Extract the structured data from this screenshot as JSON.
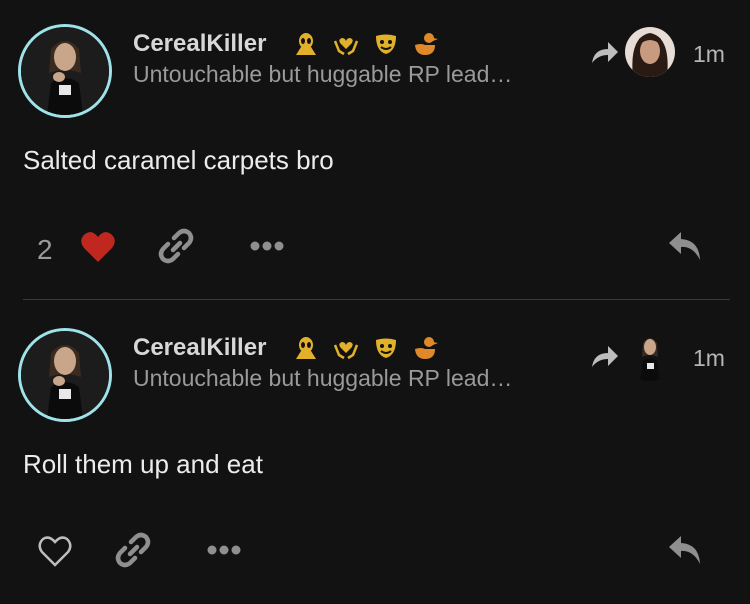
{
  "posts": [
    {
      "username": "CerealKiller",
      "bio": "Untouchable but huggable RP lead…",
      "time": "1m",
      "content": "Salted caramel carpets bro",
      "like_count": "2",
      "liked": true,
      "badges": [
        "alien-badge-icon",
        "heart-hands-badge-icon",
        "theater-masks-badge-icon",
        "duck-badge-icon"
      ]
    },
    {
      "username": "CerealKiller",
      "bio": "Untouchable but huggable RP lead…",
      "time": "1m",
      "content": "Roll them up and eat",
      "like_count": "",
      "liked": false,
      "badges": [
        "alien-badge-icon",
        "heart-hands-badge-icon",
        "theater-masks-badge-icon",
        "duck-badge-icon"
      ]
    }
  ],
  "colors": {
    "background": "#121212",
    "avatar_ring": "#9fe3ea",
    "heart_liked": "#c0271f",
    "badge_gold": "#e1b12c",
    "badge_orange": "#e0892a"
  }
}
